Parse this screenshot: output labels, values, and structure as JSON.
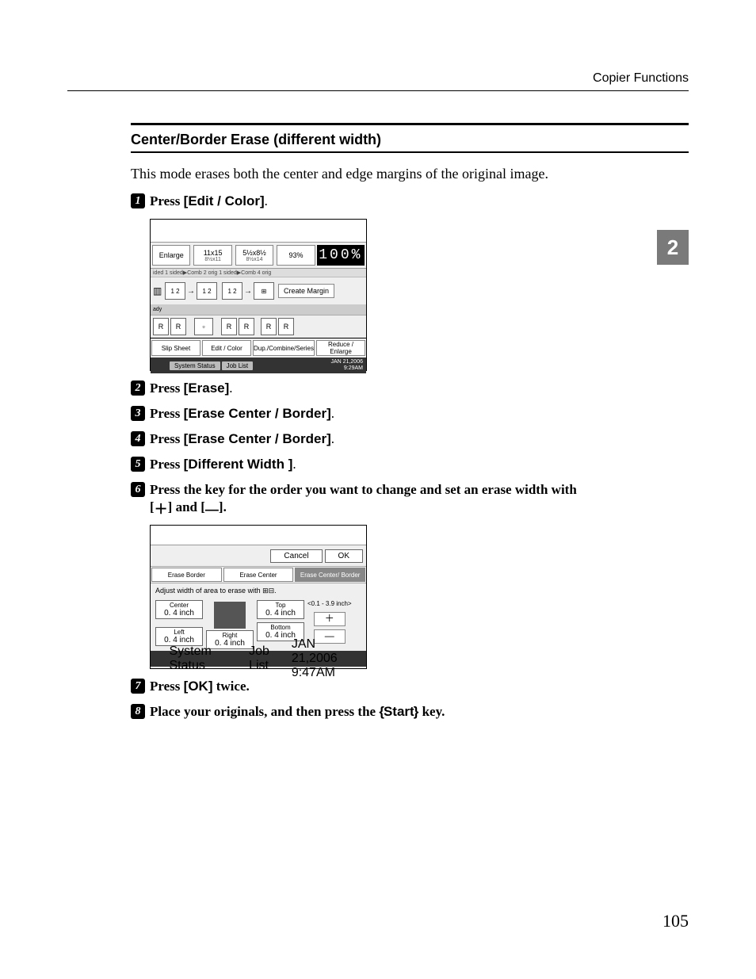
{
  "running_head": "Copier Functions",
  "side_tab": "2",
  "page_number": "105",
  "section_title": "Center/Border Erase (different width)",
  "intro": "This mode erases both the center and edge margins of the original image.",
  "steps": {
    "s1": {
      "verb": "Press ",
      "btn": "[Edit / Color]",
      "tail": "."
    },
    "s2": {
      "verb": "Press ",
      "btn": "[Erase]",
      "tail": "."
    },
    "s3": {
      "verb": "Press ",
      "btn": "[Erase Center / Border]",
      "tail": "."
    },
    "s4": {
      "verb": "Press ",
      "btn": "[Erase Center / Border]",
      "tail": "."
    },
    "s5": {
      "verb": "Press ",
      "btn": "[Different Width ]",
      "tail": "."
    },
    "s6": {
      "line1": "Press the key for the order you want to change and set an erase width with",
      "line2a": "[",
      "line2b": "] and [",
      "line2c": "]."
    },
    "s7": {
      "verb": "Press ",
      "btn": "[OK]",
      "tail": " twice."
    },
    "s8": {
      "pre": "Place your originals, and then press the ",
      "key": "Start",
      "post": " key."
    }
  },
  "shot1": {
    "enlarge": "Enlarge",
    "r1": {
      "t": "11x15",
      "b": "8½x11"
    },
    "r2": {
      "t": "5½x8½",
      "b": "8½x14"
    },
    "r3": "93%",
    "pct": "100%",
    "tabs": "ided    1 sided▶Comb 2 orig 1 sided▶Comb 4 orig",
    "create_margin": "Create Margin",
    "band": "ady",
    "fn": {
      "slip": "Slip Sheet",
      "edit": "Edit / Color",
      "dup": "Dup./Combine/Series",
      "reduce": "Reduce / Enlarge"
    },
    "status": "System Status",
    "joblist": "Job List",
    "date1": "JAN   21,2006",
    "date2": "9:29AM"
  },
  "shot2": {
    "cancel": "Cancel",
    "ok": "OK",
    "tabs": {
      "a": "Erase Border",
      "b": "Erase Center",
      "c": "Erase Center/ Border"
    },
    "hint": "Adjust width of area to erase with ⊞⊟.",
    "center": {
      "label": "Center",
      "val": "0. 4 inch"
    },
    "top": {
      "label": "Top",
      "val": "0. 4 inch"
    },
    "bottom": {
      "label": "Bottom",
      "val": "0. 4 inch"
    },
    "left": {
      "label": "Left",
      "val": "0. 4 inch"
    },
    "right": {
      "label": "Right",
      "val": "0. 4 inch"
    },
    "range": "<0.1 - 3.9 inch>",
    "plus": "＋",
    "minus": "—",
    "status": "System Status",
    "joblist": "Job List",
    "date1": "JAN   21,2006",
    "date2": "9:47AM"
  }
}
